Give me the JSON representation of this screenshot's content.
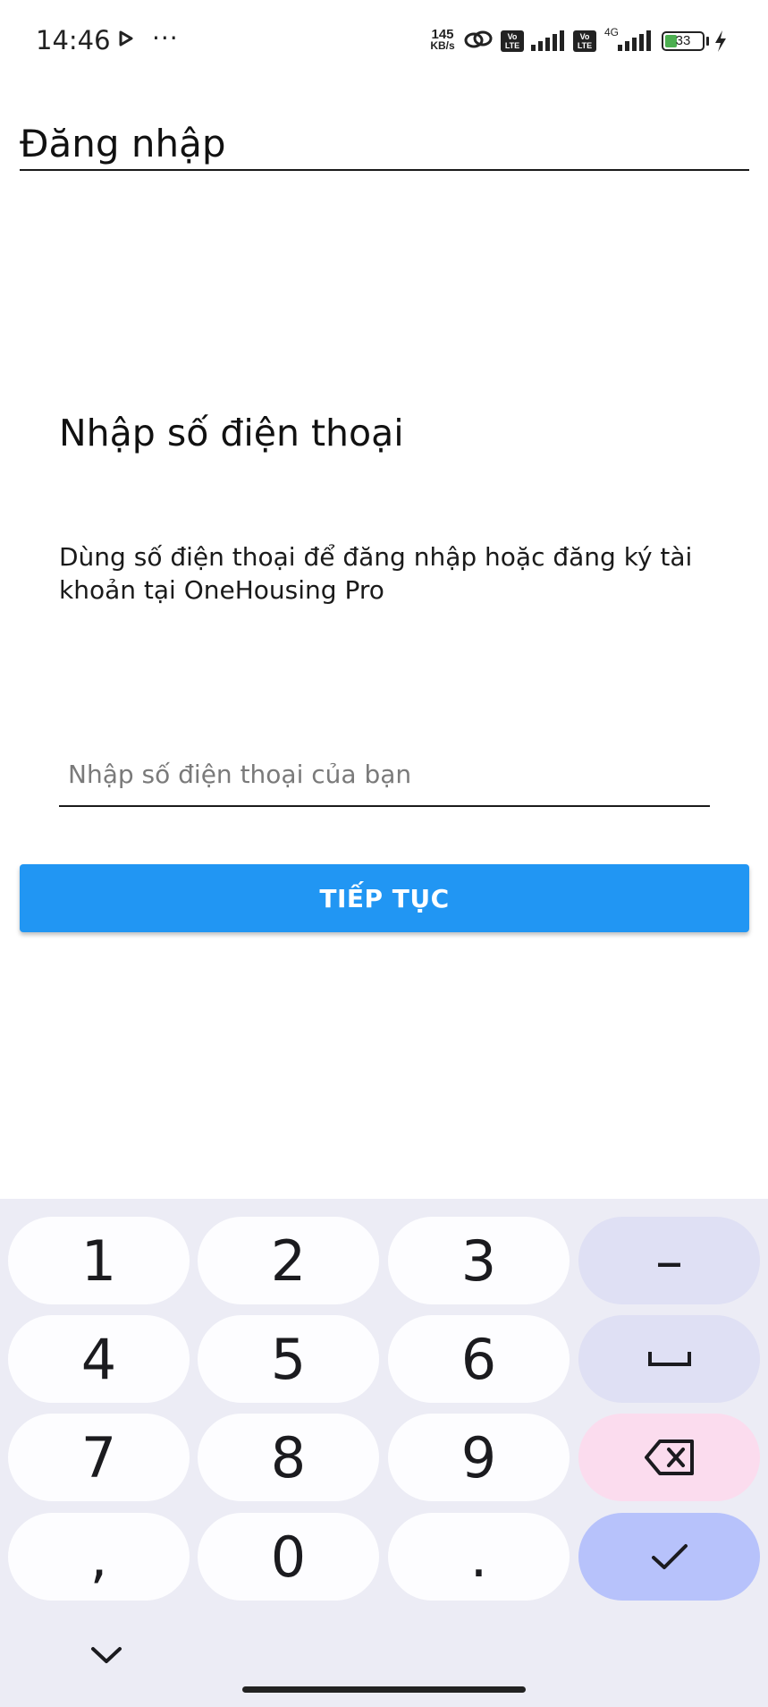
{
  "status_bar": {
    "time": "14:46",
    "more_indicator": "···",
    "net_speed_value": "145",
    "net_speed_unit": "KB/s",
    "volte_label": "Vo LTE",
    "network_type": "4G",
    "battery_level": "33",
    "battery_fraction": 0.33,
    "icons": [
      "play-icon",
      "link-icon",
      "volte-icon",
      "signal-icon",
      "battery-icon",
      "charging-bolt-icon"
    ]
  },
  "header": {
    "title": "Đăng nhập"
  },
  "main": {
    "heading": "Nhập số điện thoại",
    "description": "Dùng số điện thoại để đăng nhập hoặc đăng ký tài khoản tại OneHousing Pro",
    "phone_placeholder": "Nhập số điện thoại của bạn",
    "phone_value": "",
    "continue_label": "TIẾP TỤC",
    "accent_color": "#2196f3"
  },
  "keyboard": {
    "keys": [
      {
        "label": "1"
      },
      {
        "label": "2"
      },
      {
        "label": "3"
      },
      {
        "label": "–"
      },
      {
        "label": "4"
      },
      {
        "label": "5"
      },
      {
        "label": "6"
      },
      {
        "label": "␣"
      },
      {
        "label": "7"
      },
      {
        "label": "8"
      },
      {
        "label": "9"
      },
      {
        "label": "⌫"
      },
      {
        "label": ","
      },
      {
        "label": "0"
      },
      {
        "label": "."
      },
      {
        "label": "✓"
      }
    ],
    "colors": {
      "background": "#ececf5",
      "key": "#fdfdff",
      "function_key": "#dfe0f4",
      "delete_key": "#fbdcee",
      "done_key": "#b7c2fb"
    },
    "collapse_icon": "chevron-down-icon"
  }
}
